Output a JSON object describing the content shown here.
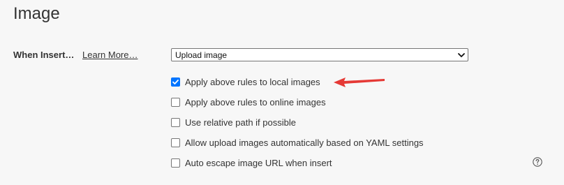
{
  "section": {
    "title": "Image"
  },
  "when_insert": {
    "label": "When Insert…",
    "learn_more": "Learn More…",
    "select_value": "Upload image"
  },
  "options": [
    {
      "label": "Apply above rules to local images",
      "checked": true
    },
    {
      "label": "Apply above rules to online images",
      "checked": false
    },
    {
      "label": "Use relative path if possible",
      "checked": false
    },
    {
      "label": "Allow upload images automatically based on YAML settings",
      "checked": false
    },
    {
      "label": "Auto escape image URL when insert",
      "checked": false
    }
  ],
  "icons": {
    "select": "chevron-down-icon",
    "checkbox": "checkmark-icon",
    "annotation": "red-arrow-icon",
    "help": "question-circle-icon"
  },
  "colors": {
    "checkbox_checked": "#0075ff",
    "annotation_arrow": "#e53935",
    "text": "#333333",
    "background": "#f7f7f7"
  }
}
